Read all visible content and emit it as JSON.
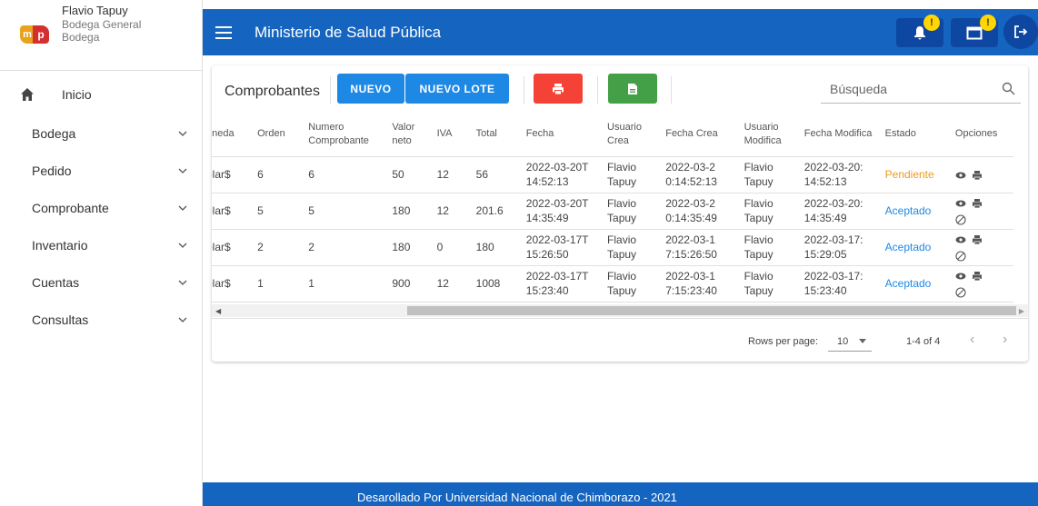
{
  "profile": {
    "name": "Flavio Tapuy",
    "subtitle1": "Bodega General",
    "subtitle2": "Bodega",
    "logo_left": "m",
    "logo_right": "p"
  },
  "sidebar": {
    "home_label": "Inicio",
    "items": [
      {
        "label": "Bodega"
      },
      {
        "label": "Pedido"
      },
      {
        "label": "Comprobante"
      },
      {
        "label": "Inventario"
      },
      {
        "label": "Cuentas"
      },
      {
        "label": "Consultas"
      }
    ]
  },
  "topbar": {
    "title": "Ministerio de Salud Pública",
    "notifications_badge": "!",
    "calendar_badge": "!"
  },
  "card": {
    "title": "Comprobantes",
    "new_label": "NUEVO",
    "new_batch_label": "NUEVO LOTE",
    "search_placeholder": "Búsqueda"
  },
  "table": {
    "headers": [
      "oneda",
      "Orden",
      "Numero Comprobante",
      "Valor neto",
      "IVA",
      "Total",
      "Fecha",
      "Usuario Crea",
      "Fecha Crea",
      "Usuario Modifica",
      "Fecha Modifica",
      "Estado",
      "Opciones"
    ],
    "rows": [
      {
        "moneda": "olar$",
        "orden": "6",
        "numero": "6",
        "valor": "50",
        "iva": "12",
        "total": "56",
        "fecha": "2022-03-20T14:52:13",
        "usuario_crea": "Flavio Tapuy",
        "fecha_crea": "2022-03-20:14:52:13",
        "usuario_mod": "Flavio Tapuy",
        "fecha_mod": "2022-03-20:14:52:13",
        "estado": "Pendiente"
      },
      {
        "moneda": "olar$",
        "orden": "5",
        "numero": "5",
        "valor": "180",
        "iva": "12",
        "total": "201.6",
        "fecha": "2022-03-20T14:35:49",
        "usuario_crea": "Flavio Tapuy",
        "fecha_crea": "2022-03-20:14:35:49",
        "usuario_mod": "Flavio Tapuy",
        "fecha_mod": "2022-03-20:14:35:49",
        "estado": "Aceptado"
      },
      {
        "moneda": "olar$",
        "orden": "2",
        "numero": "2",
        "valor": "180",
        "iva": "0",
        "total": "180",
        "fecha": "2022-03-17T15:26:50",
        "usuario_crea": "Flavio Tapuy",
        "fecha_crea": "2022-03-17:15:26:50",
        "usuario_mod": "Flavio Tapuy",
        "fecha_mod": "2022-03-17:15:29:05",
        "estado": "Aceptado"
      },
      {
        "moneda": "olar$",
        "orden": "1",
        "numero": "1",
        "valor": "900",
        "iva": "12",
        "total": "1008",
        "fecha": "2022-03-17T15:23:40",
        "usuario_crea": "Flavio Tapuy",
        "fecha_crea": "2022-03-17:15:23:40",
        "usuario_mod": "Flavio Tapuy",
        "fecha_mod": "2022-03-17:15:23:40",
        "estado": "Aceptado"
      }
    ]
  },
  "pagination": {
    "rows_label": "Rows per page:",
    "rows_value": "10",
    "range": "1-4 of 4"
  },
  "footer": {
    "text": "Desarollado Por Universidad Nacional de Chimborazo - 2021"
  },
  "colors": {
    "primary": "#1565c0",
    "pending": "#ef9a1a",
    "accepted": "#1e88e5",
    "print_button": "#f44336",
    "excel_button": "#43a047"
  }
}
